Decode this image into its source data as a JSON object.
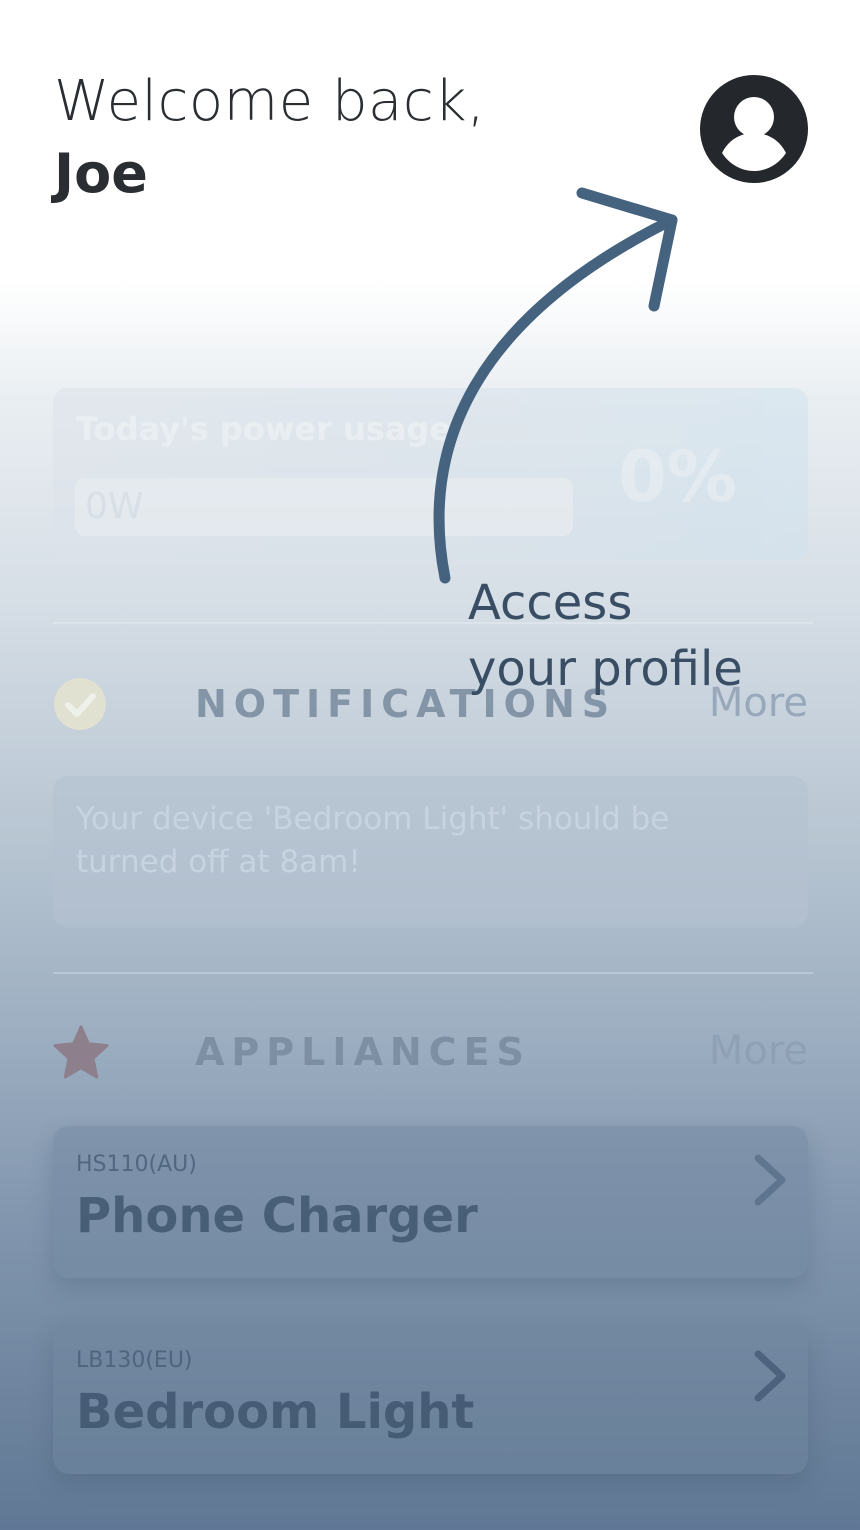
{
  "header": {
    "greeting_line1": "Welcome back,",
    "greeting_name": "Joe",
    "avatar_icon": "account-circle-icon"
  },
  "power": {
    "title": "Today's power usage",
    "value": "0W",
    "percent": "0%"
  },
  "notifications": {
    "title": "NOTIFICATIONS",
    "more": "More",
    "icon": "check-circle-icon",
    "message": "Your device 'Bedroom Light' should be turned off at 8am!"
  },
  "appliances": {
    "title": "APPLIANCES",
    "more": "More",
    "icon": "star-icon",
    "items": [
      {
        "model": "HS110(AU)",
        "name": "Phone Charger"
      },
      {
        "model": "LB130(EU)",
        "name": "Bedroom Light"
      }
    ]
  },
  "coach_mark": {
    "line1": "Access",
    "line2": "your profile"
  },
  "colors": {
    "text_dark": "#2a2d31",
    "hint_text": "#394e64",
    "arrow": "#45627f",
    "scrim_bottom": "#607895"
  }
}
